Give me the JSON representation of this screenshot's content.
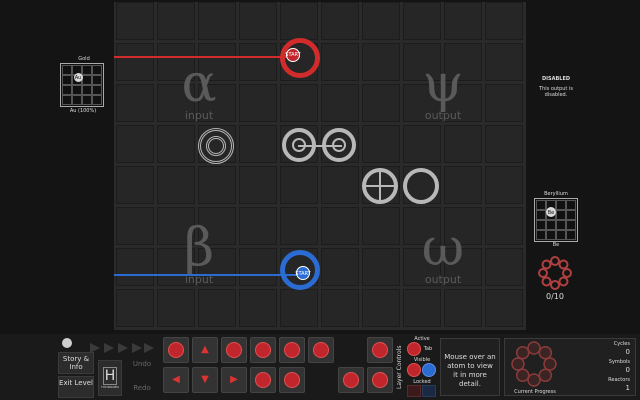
{
  "grid": {
    "quadrants": [
      {
        "glyph": "α",
        "word": "input"
      },
      {
        "glyph": "ψ",
        "word": "output"
      },
      {
        "glyph": "β",
        "word": "input"
      },
      {
        "glyph": "ω",
        "word": "output"
      }
    ],
    "atoms": {
      "red_start": "START",
      "blue_start": "START"
    },
    "colors": {
      "red": "#d22b2b",
      "blue": "#2b6cd2",
      "grey": "#b8b8b8"
    }
  },
  "left_panel": {
    "element_name": "Gold",
    "element_symbol": "Au",
    "element_caption": "Au (100%)"
  },
  "right_panel": {
    "status_title": "DISABLED",
    "status_text": "This output is disabled.",
    "target_name": "Beryllium",
    "target_symbol": "Be",
    "target_caption": "Be",
    "progress": "0/10"
  },
  "bottom": {
    "story_button": "Story & Info",
    "exit_button": "Exit Level",
    "hydrogen_symbol": "H",
    "hydrogen_name": "HYDROGEN",
    "undo": "Undo",
    "redo": "Redo",
    "layer_controls": "Layer Controls",
    "active": "Active",
    "tab": "Tab",
    "visible": "Visible",
    "locked": "Locked",
    "info_text": "Mouse over an atom to view it in more detail.",
    "current_progress": "Current Progress",
    "cycles_label": "Cycles",
    "cycles_value": "0",
    "symbols_label": "Symbols",
    "symbols_value": "0",
    "reactors_label": "Reactors",
    "reactors_value": "1"
  }
}
